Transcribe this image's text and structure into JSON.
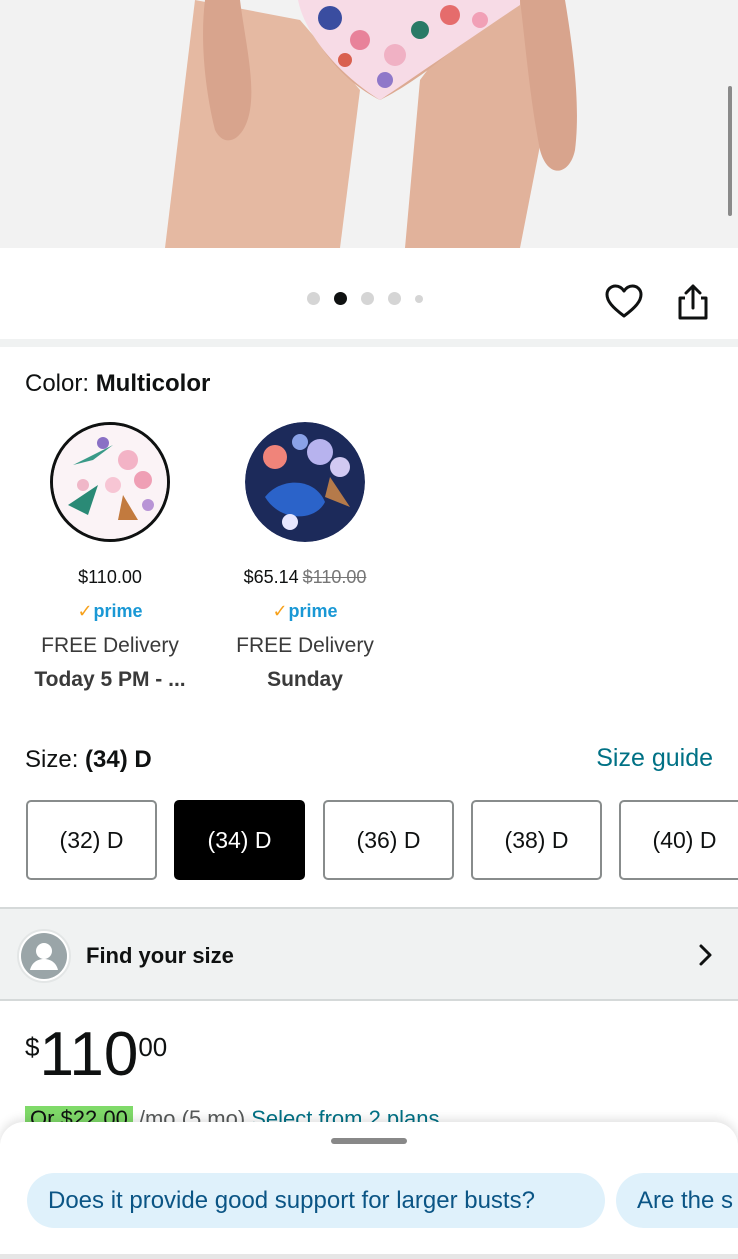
{
  "product_image": {
    "carousel_dots": 5,
    "active_index": 1
  },
  "actions": {
    "wishlist_icon": "heart-icon",
    "share_icon": "share-icon"
  },
  "color": {
    "label": "Color: ",
    "value": "Multicolor",
    "options": [
      {
        "price": "$110.00",
        "list_price": "",
        "prime": "prime",
        "delivery": "FREE Delivery",
        "when": "Today 5 PM - ...",
        "selected": true
      },
      {
        "price": "$65.14",
        "list_price": "$110.00",
        "prime": "prime",
        "delivery": "FREE Delivery",
        "when": "Sunday",
        "selected": false
      }
    ]
  },
  "size": {
    "label": "Size: ",
    "value": "(34) D",
    "guide": "Size guide",
    "options": [
      "(32) D",
      "(34) D",
      "(36) D",
      "(38) D",
      "(40) D"
    ],
    "selected_index": 1
  },
  "find_size": {
    "label": "Find your size"
  },
  "price": {
    "symbol": "$",
    "whole": "110",
    "fraction": "00"
  },
  "installments": {
    "monthly": "Or $22.00",
    "term": "/mo (5 mo)",
    "link": "Select from 2 plans"
  },
  "questions": [
    "Does it provide good support for larger busts?",
    "Are the s"
  ],
  "colors": {
    "link": "#007185",
    "chip_bg": "#dff1fb",
    "prime_blue": "#1a98d5",
    "installment_green": "#7fda69"
  }
}
